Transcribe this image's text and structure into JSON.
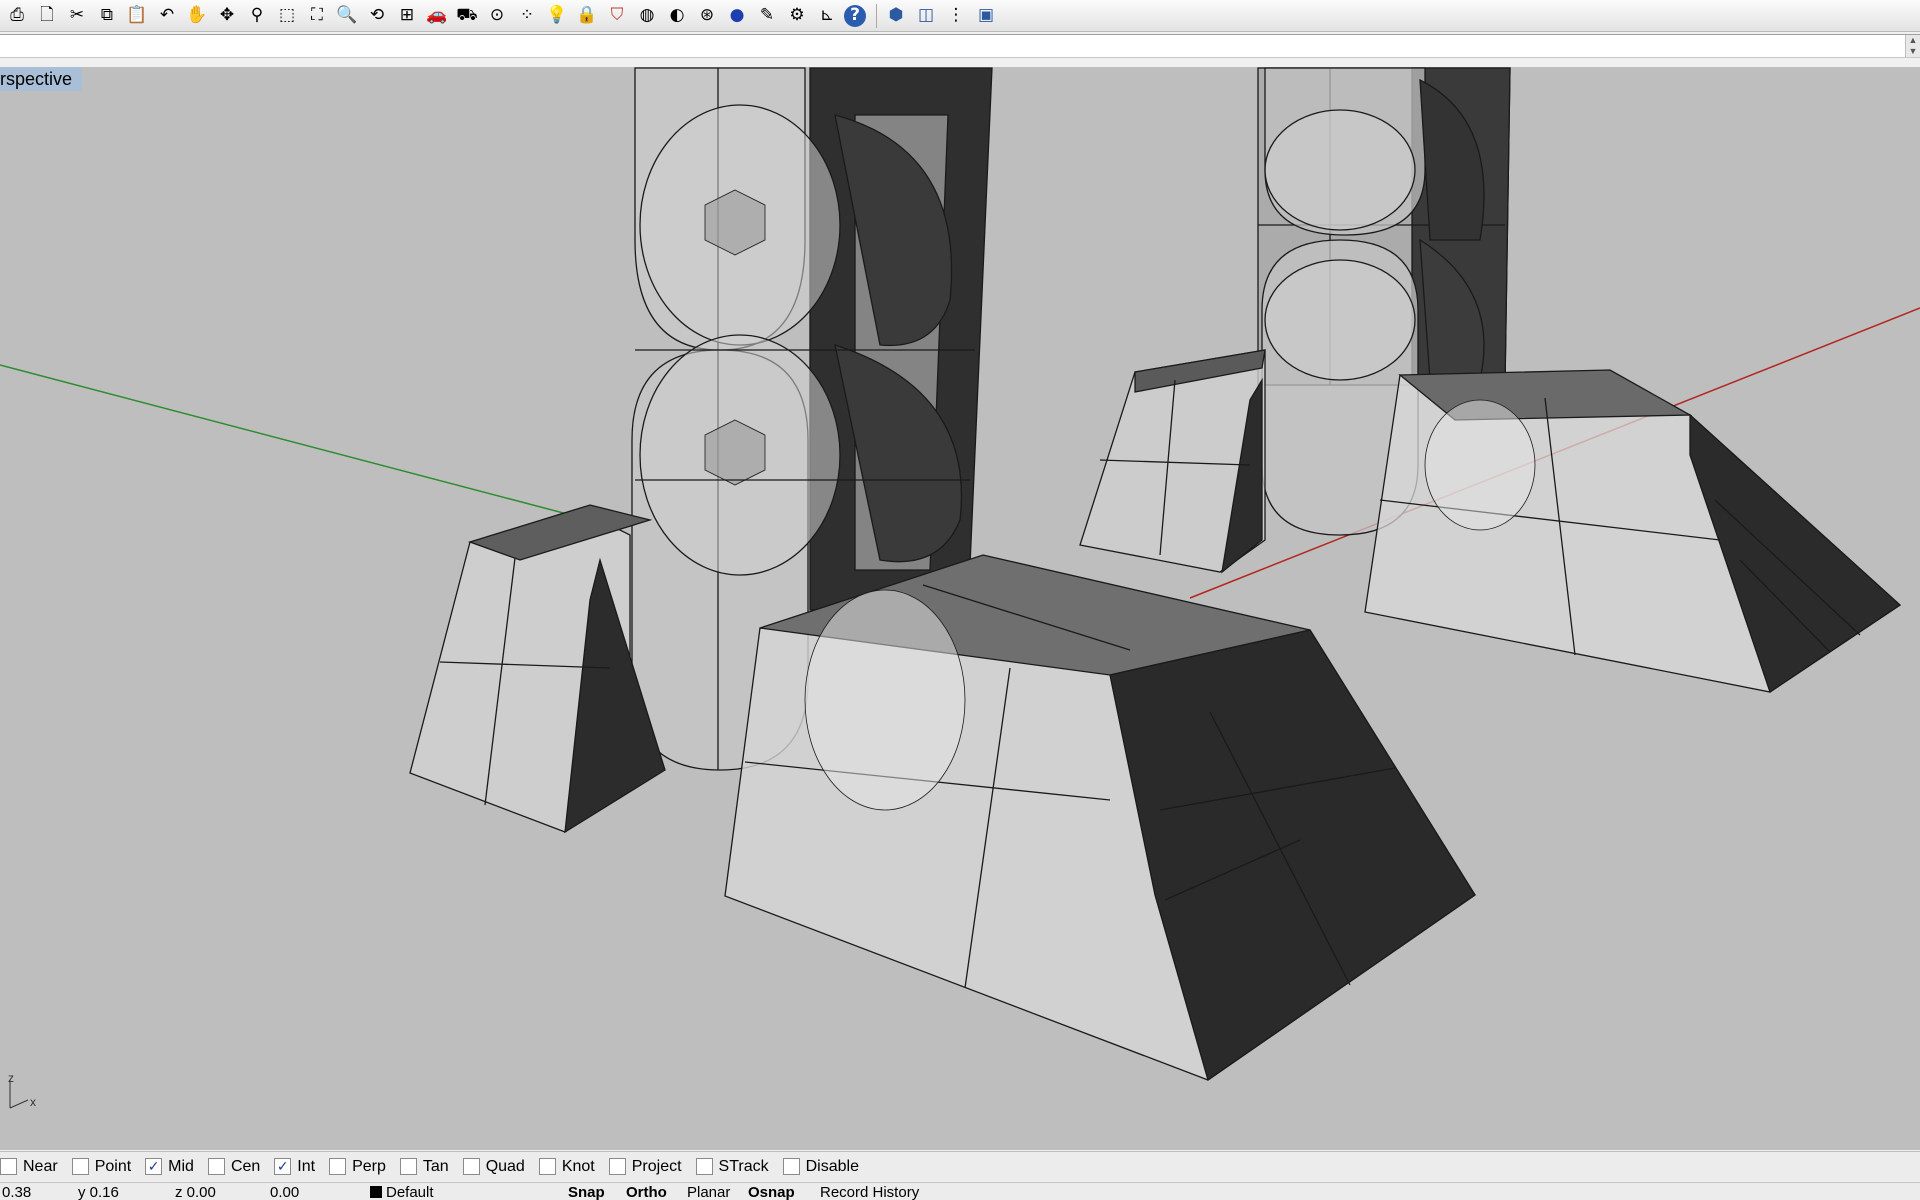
{
  "toolbar": {
    "buttons": [
      {
        "name": "print-icon",
        "glyph": "⎙"
      },
      {
        "name": "new-file-icon",
        "glyph": "🗋"
      },
      {
        "name": "cut-icon",
        "glyph": "✂"
      },
      {
        "name": "copy-icon",
        "glyph": "⧉"
      },
      {
        "name": "paste-icon",
        "glyph": "📋"
      },
      {
        "name": "undo-icon",
        "glyph": "↶"
      },
      {
        "name": "pan-hand-icon",
        "glyph": "✋"
      },
      {
        "name": "rotate-view-icon",
        "glyph": "✥"
      },
      {
        "name": "zoom-dynamic-icon",
        "glyph": "⚲"
      },
      {
        "name": "zoom-window-icon",
        "glyph": "⬚"
      },
      {
        "name": "zoom-extents-icon",
        "glyph": "⛶"
      },
      {
        "name": "zoom-selected-icon",
        "glyph": "🔍"
      },
      {
        "name": "undo-view-change-icon",
        "glyph": "⟲"
      },
      {
        "name": "four-viewports-icon",
        "glyph": "⊞"
      },
      {
        "name": "car-icon",
        "glyph": "🚗"
      },
      {
        "name": "render-preview-icon",
        "glyph": "⛟"
      },
      {
        "name": "select-icon",
        "glyph": "⊙"
      },
      {
        "name": "points-icon",
        "glyph": "⁘"
      },
      {
        "name": "light-bulb-icon",
        "glyph": "💡"
      },
      {
        "name": "lock-icon",
        "glyph": "🔒"
      },
      {
        "name": "layers-icon",
        "glyph": "⛉"
      },
      {
        "name": "color-wheel-icon",
        "glyph": "◍"
      },
      {
        "name": "surface-analysis-icon",
        "glyph": "◐"
      },
      {
        "name": "mesh-icon",
        "glyph": "⊛"
      },
      {
        "name": "render-sphere-icon",
        "glyph": "●"
      },
      {
        "name": "highlight-icon",
        "glyph": "✎"
      },
      {
        "name": "options-gear-icon",
        "glyph": "⚙"
      },
      {
        "name": "dimension-icon",
        "glyph": "⊾"
      },
      {
        "name": "help-icon",
        "glyph": "?"
      },
      {
        "name": "sep",
        "glyph": ""
      },
      {
        "name": "shaded-box-icon",
        "glyph": "⬢"
      },
      {
        "name": "wireframe-box-icon",
        "glyph": "◫"
      },
      {
        "name": "more-options-icon",
        "glyph": "⋮"
      },
      {
        "name": "viewport-layout-icon",
        "glyph": "▣"
      }
    ]
  },
  "viewport": {
    "title": "rspective",
    "axis_z": "z",
    "axis_x": "x",
    "colors": {
      "background": "#bebebe",
      "x_axis": "#b3261e",
      "y_axis": "#2e8b2e",
      "edge": "#111111",
      "dark_face": "#2b2b2b"
    }
  },
  "osnap": {
    "items": [
      {
        "label": "Near",
        "checked": false
      },
      {
        "label": "Point",
        "checked": false
      },
      {
        "label": "Mid",
        "checked": true
      },
      {
        "label": "Cen",
        "checked": false
      },
      {
        "label": "Int",
        "checked": true
      },
      {
        "label": "Perp",
        "checked": false
      },
      {
        "label": "Tan",
        "checked": false
      },
      {
        "label": "Quad",
        "checked": false
      },
      {
        "label": "Knot",
        "checked": false
      },
      {
        "label": "Project",
        "checked": false
      },
      {
        "label": "STrack",
        "checked": false
      },
      {
        "label": "Disable",
        "checked": false
      }
    ]
  },
  "status": {
    "x": "0.38",
    "y": "y 0.16",
    "z": "z 0.00",
    "d": "0.00",
    "layer": "Default",
    "snap": "Snap",
    "ortho": "Ortho",
    "planar": "Planar",
    "osnap": "Osnap",
    "history": "Record History"
  }
}
